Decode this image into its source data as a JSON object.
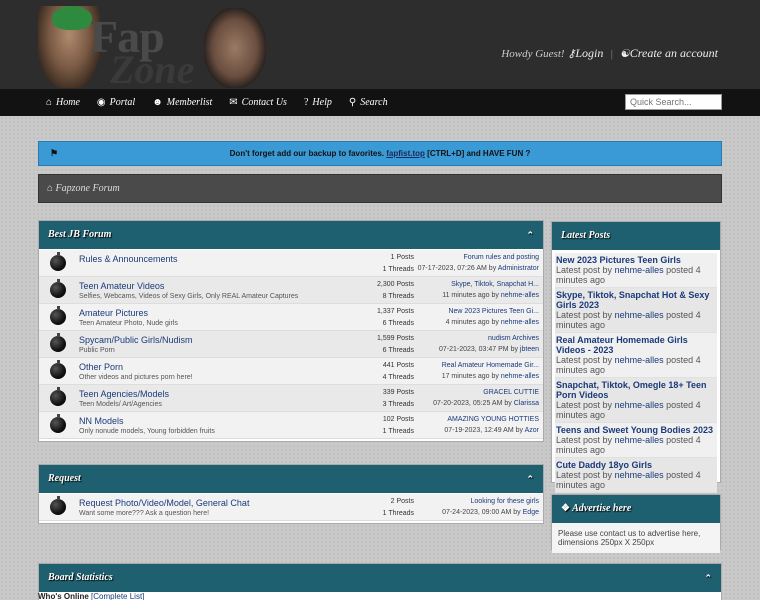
{
  "header": {
    "logo_text_1": "Fap",
    "logo_text_2": "Zone",
    "welcome_prefix": "Howdy Guest!",
    "login_label": "Login",
    "signup_label": "Create an account"
  },
  "nav": {
    "items": [
      {
        "label": "Home",
        "icon": "home-icon"
      },
      {
        "label": "Portal",
        "icon": "globe-icon"
      },
      {
        "label": "Memberlist",
        "icon": "user-icon"
      },
      {
        "label": "Contact Us",
        "icon": "envelope-icon"
      },
      {
        "label": "Help",
        "icon": "question-icon"
      },
      {
        "label": "Search",
        "icon": "search-icon"
      }
    ],
    "search_placeholder": "Quick Search..."
  },
  "notice": {
    "text_before": "Don't forget add our backup to favorites.",
    "link": "fapfist.top",
    "text_after": "[CTRL+D] and HAVE FUN ?"
  },
  "breadcrumb": "Fapzone Forum",
  "category_main": {
    "title": "Best JB Forum",
    "forums": [
      {
        "title": "Rules & Announcements",
        "desc": "",
        "posts": "1 Posts",
        "threads": "1 Threads",
        "last_title": "Forum rules and posting",
        "last_date": "07-17-2023, 07:26 AM by",
        "last_user": "Administrator"
      },
      {
        "title": "Teen Amateur Videos",
        "desc": "Selfies, Webcams, Videos of Sexy Girls, Only REAL Amateur Captures",
        "posts": "2,300 Posts",
        "threads": "8 Threads",
        "last_title": "Skype, Tiktok, Snapchat H...",
        "last_date": "11 minutes ago by",
        "last_user": "nehme-alles"
      },
      {
        "title": "Amateur Pictures",
        "desc": "Teen Amateur Photo, Nude girls",
        "posts": "1,337 Posts",
        "threads": "6 Threads",
        "last_title": "New 2023 Pictures Teen Gi...",
        "last_date": "4 minutes ago by",
        "last_user": "nehme-alles"
      },
      {
        "title": "Spycam/Public Girls/Nudism",
        "desc": "Public Porn",
        "posts": "1,599 Posts",
        "threads": "6 Threads",
        "last_title": "nudism Archives",
        "last_date": "07-21-2023, 03:47 PM by",
        "last_user": "jbteen"
      },
      {
        "title": "Other Porn",
        "desc": "Other videos and pictures porn here!",
        "posts": "441 Posts",
        "threads": "4 Threads",
        "last_title": "Real Amateur Homemade Gir...",
        "last_date": "17 minutes ago by",
        "last_user": "nehme-alles"
      },
      {
        "title": "Teen Agencies/Models",
        "desc": "Teen Models/ Art/Agencies",
        "posts": "339 Posts",
        "threads": "3 Threads",
        "last_title": "GRACEL CUTTIE",
        "last_date": "07-20-2023, 05:25 AM by",
        "last_user": "Clarissa"
      },
      {
        "title": "NN Models",
        "desc": "Only nonude models, Young forbidden fruits",
        "posts": "102 Posts",
        "threads": "1 Threads",
        "last_title": "AMAZING YOUNG HOTTIES",
        "last_date": "07-19-2023, 12:49 AM by",
        "last_user": "Azor"
      }
    ]
  },
  "category_request": {
    "title": "Request",
    "forums": [
      {
        "title": "Request Photo/Video/Model, General Chat",
        "desc": "Want some more??? Ask a question here!",
        "posts": "2 Posts",
        "threads": "1 Threads",
        "last_title": "Looking for these girls",
        "last_date": "07-24-2023, 09:00 AM by",
        "last_user": "Edge"
      }
    ]
  },
  "latest_posts": {
    "title": "Latest Posts",
    "items": [
      {
        "title": "New 2023 Pictures Teen Girls",
        "prefix": "Latest post by",
        "user": "nehme-alles",
        "suffix": "posted 4 minutes ago"
      },
      {
        "title": "Skype, Tiktok, Snapchat Hot & Sexy Girls 2023",
        "prefix": "Latest post by",
        "user": "nehme-alles",
        "suffix": "posted 4 minutes ago"
      },
      {
        "title": "Real Amateur Homemade Girls Videos - 2023",
        "prefix": "Latest post by",
        "user": "nehme-alles",
        "suffix": "posted 4 minutes ago"
      },
      {
        "title": "Snapchat, Tiktok, Omegle 18+ Teen Porn Videos",
        "prefix": "Latest post by",
        "user": "nehme-alles",
        "suffix": "posted 4 minutes ago"
      },
      {
        "title": "Teens and Sweet Young Bodies 2023",
        "prefix": "Latest post by",
        "user": "nehme-alles",
        "suffix": "posted 4 minutes ago"
      },
      {
        "title": "Cute Daddy 18yo Girls",
        "prefix": "Latest post by",
        "user": "nehme-alles",
        "suffix": "posted 4 minutes ago"
      }
    ]
  },
  "advertise": {
    "title": "Advertise here",
    "body": "Please use contact us to advertise here, dimensions 250px X 250px"
  },
  "stats": {
    "title": "Board Statistics",
    "whos_online": "Who's Online",
    "complete_list": "[Complete List]"
  },
  "collapse_glyph": "⌃"
}
